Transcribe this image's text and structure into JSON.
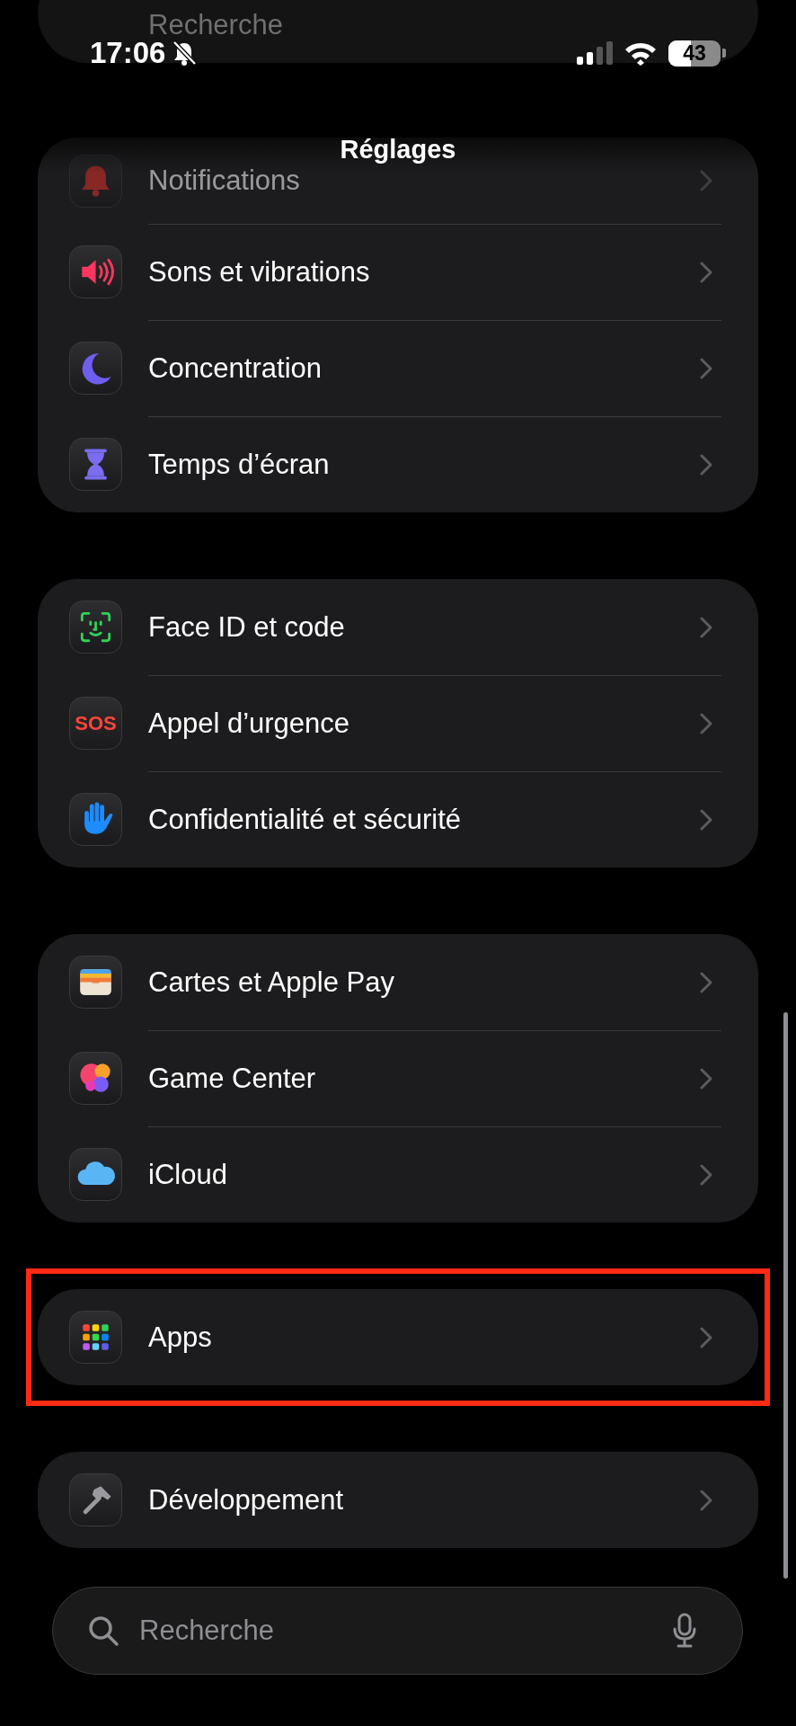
{
  "status_bar": {
    "time": "17:06",
    "battery": "43"
  },
  "ghost_search": {
    "placeholder": "Recherche"
  },
  "title": "Réglages",
  "groups": [
    {
      "highlighted": false,
      "rows": [
        {
          "kind": "notifications",
          "label": "Notifications",
          "blurred": true
        },
        {
          "kind": "sound",
          "label": "Sons et vibrations",
          "blurred": false
        },
        {
          "kind": "focus",
          "label": "Concentration",
          "blurred": false
        },
        {
          "kind": "screentime",
          "label": "Temps d’écran",
          "blurred": false
        }
      ]
    },
    {
      "highlighted": false,
      "rows": [
        {
          "kind": "faceid",
          "label": "Face ID et code",
          "blurred": false
        },
        {
          "kind": "sos",
          "label": "Appel d’urgence",
          "icon_text": "SOS",
          "blurred": false
        },
        {
          "kind": "privacy",
          "label": "Confidentialité et sécurité",
          "blurred": false
        }
      ]
    },
    {
      "highlighted": false,
      "rows": [
        {
          "kind": "wallet",
          "label": "Cartes et Apple Pay",
          "blurred": false
        },
        {
          "kind": "gamecenter",
          "label": "Game Center",
          "blurred": false
        },
        {
          "kind": "icloud",
          "label": "iCloud",
          "blurred": false
        }
      ]
    },
    {
      "highlighted": true,
      "rows": [
        {
          "kind": "apps",
          "label": "Apps",
          "blurred": false
        }
      ]
    },
    {
      "highlighted": false,
      "rows": [
        {
          "kind": "developer",
          "label": "Développement",
          "blurred": false
        }
      ]
    }
  ],
  "search": {
    "placeholder": "Recherche"
  }
}
